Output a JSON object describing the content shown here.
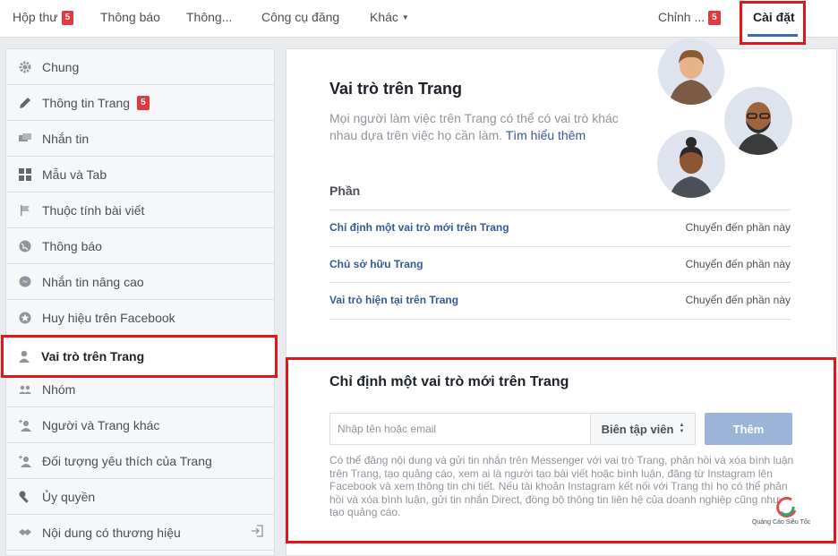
{
  "topnav": {
    "items": [
      {
        "label": "Hộp thư",
        "badge": "5"
      },
      {
        "label": "Thông báo"
      },
      {
        "label": "Thông..."
      },
      {
        "label": "Công cụ đăng"
      },
      {
        "label": "Khác"
      }
    ],
    "edit": {
      "label": "Chỉnh ...",
      "badge": "5"
    },
    "settings": {
      "label": "Cài đặt"
    }
  },
  "sidebar": {
    "items": [
      {
        "label": "Chung",
        "icon": "gear-icon"
      },
      {
        "label": "Thông tin Trang",
        "icon": "pencil-icon",
        "badge": "5"
      },
      {
        "label": "Nhắn tin",
        "icon": "chat-icon"
      },
      {
        "label": "Mẫu và Tab",
        "icon": "grid-icon"
      },
      {
        "label": "Thuộc tính bài viết",
        "icon": "flag-icon"
      },
      {
        "label": "Thông báo",
        "icon": "globe-icon"
      },
      {
        "label": "Nhắn tin nâng cao",
        "icon": "messenger-icon"
      },
      {
        "label": "Huy hiệu trên Facebook",
        "icon": "star-icon"
      },
      {
        "label": "Vai trò trên Trang",
        "icon": "person-icon",
        "active": true
      },
      {
        "label": "Nhóm",
        "icon": "group-icon"
      },
      {
        "label": "Người và Trang khác",
        "icon": "person-plus-icon"
      },
      {
        "label": "Đối tượng yêu thích của Trang",
        "icon": "person-plus-icon"
      },
      {
        "label": "Ủy quyền",
        "icon": "wrench-icon"
      },
      {
        "label": "Nội dung có thương hiệu",
        "icon": "handshake-icon"
      }
    ]
  },
  "main": {
    "title": "Vai trò trên Trang",
    "description": "Mọi người làm việc trên Trang có thể có vai trò khác nhau dựa trên việc họ cần làm.",
    "learn_more": "Tìm hiểu thêm",
    "section": "Phần",
    "rows": [
      {
        "label": "Chỉ định một vai trò mới trên Trang",
        "action": "Chuyển đến phần này"
      },
      {
        "label": "Chủ sở hữu Trang",
        "action": "Chuyển đến phần này"
      },
      {
        "label": "Vai trò hiện tại trên Trang",
        "action": "Chuyển đến phần này"
      }
    ]
  },
  "assign": {
    "title": "Chỉ định một vai trò mới trên Trang",
    "input_placeholder": "Nhập tên hoặc email",
    "role_selected": "Biên tập viên",
    "add_button": "Thêm",
    "help_text": "Có thể đăng nội dung và gửi tin nhắn trên Messenger với vai trò Trang, phản hồi và xóa bình luận trên Trang, tạo quảng cáo, xem ai là người tạo bài viết hoặc bình luận, đăng từ Instagram lên Facebook và xem thông tin chi tiết. Nếu tài khoản Instagram kết nối với Trang thì họ có thể phản hồi và xóa bình luận, gửi tin nhắn Direct, đồng bộ thông tin liên hệ của doanh nghiệp cũng như tạo quảng cáo.",
    "watermark": "Quảng Cáo Siêu Tốc"
  },
  "colors": {
    "highlight_border": "#e0161d",
    "link": "#365899",
    "badge": "#e0393e",
    "button_disabled": "#9cb4d8",
    "underline": "#4267b2"
  }
}
